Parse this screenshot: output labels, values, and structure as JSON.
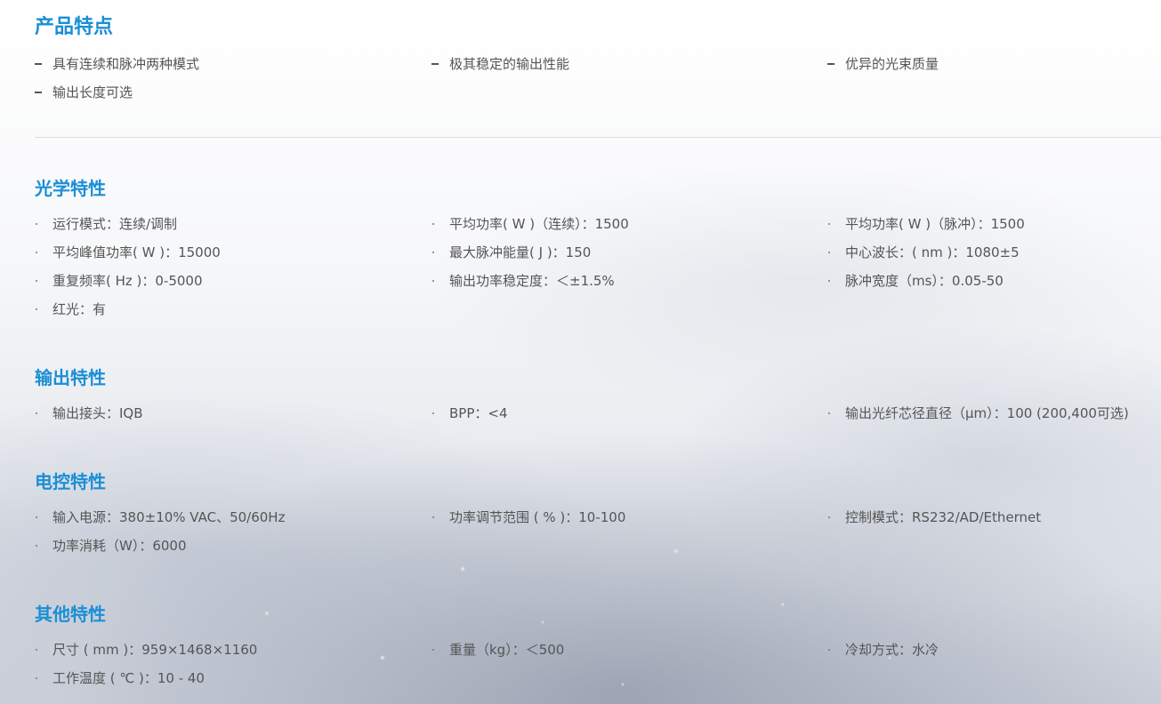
{
  "features": {
    "title": "产品特点",
    "items": [
      "具有连续和脉冲两种模式",
      "极其稳定的输出性能",
      "优异的光束质量",
      "输出长度可选"
    ]
  },
  "optical": {
    "title": "光学特性",
    "items": [
      "运行模式：连续/调制",
      "平均功率( W )（连续）：1500",
      "平均功率( W )（脉冲）：1500",
      "平均峰值功率( W )：15000",
      "最大脉冲能量( J )：150",
      "中心波长：( nm )：1080±5",
      "重复频率( Hz )：0-5000",
      "输出功率稳定度：＜±1.5%",
      "脉冲宽度（ms）：0.05-50",
      "红光：有"
    ]
  },
  "output": {
    "title": "输出特性",
    "items": [
      "输出接头：IQB",
      "BPP：<4",
      "输出光纤芯径直径（μm）：100 (200,400可选)"
    ]
  },
  "electrical": {
    "title": "电控特性",
    "items": [
      "输入电源：380±10% VAC、50/60Hz",
      "功率调节范围 ( % )：10-100",
      "控制模式：RS232/AD/Ethernet",
      "功率消耗（W）：6000"
    ]
  },
  "other": {
    "title": "其他特性",
    "items": [
      "尺寸 ( mm )：959×1468×1160",
      "重量（kg）：＜500",
      "冷却方式：水冷",
      "工作温度 ( ℃ )：10 - 40"
    ]
  }
}
